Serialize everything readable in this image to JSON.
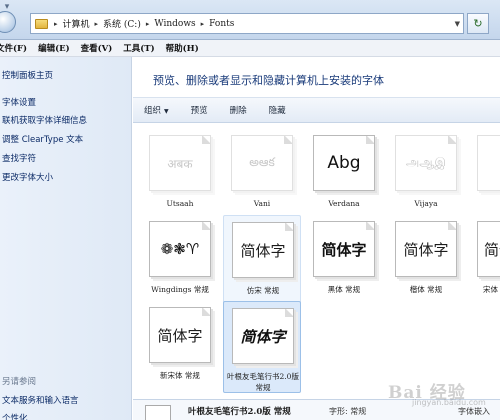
{
  "address": {
    "crumbs": [
      "计算机",
      "系统 (C:)",
      "Windows",
      "Fonts"
    ],
    "separator": "▸"
  },
  "menu": [
    "文件(F)",
    "编辑(E)",
    "查看(V)",
    "工具(T)",
    "帮助(H)"
  ],
  "sidebar": {
    "home": "控制面板主页",
    "links": [
      "字体设置",
      "联机获取字体详细信息",
      "调整 ClearType 文本",
      "查找字符",
      "更改字体大小"
    ],
    "see_also": "另请参阅",
    "bottom_links": [
      "文本服务和输入语言",
      "个性化"
    ]
  },
  "header": {
    "title": "预览、删除或者显示和隐藏计算机上安装的字体"
  },
  "toolbar": {
    "organize": "组织",
    "preview": "预览",
    "delete": "删除",
    "hide": "隐藏"
  },
  "fonts": [
    {
      "name": "Utsaah",
      "sample": "अबक"
    },
    {
      "name": "Vani",
      "sample": "అఆక"
    },
    {
      "name": "Verdana",
      "sample": "Abg"
    },
    {
      "name": "Vijaya",
      "sample": "அஆஇ"
    },
    {
      "name": "Wingdings 常规",
      "sample": "❁❃♈"
    },
    {
      "name": "仿宋 常规",
      "sample": "简体字"
    },
    {
      "name": "黑体 常规",
      "sample": "简体字"
    },
    {
      "name": "楷体 常规",
      "sample": "简体字"
    },
    {
      "name": "宋体",
      "sample": "简体"
    },
    {
      "name": "新宋体 常规",
      "sample": "简体字"
    },
    {
      "name": "叶根友毛笔行书2.0版 常规",
      "sample": "简体字"
    }
  ],
  "details": {
    "name": "叶根友毛笔行书2.0版 常规",
    "style": "字形: 常规",
    "embed": "字体嵌入"
  },
  "watermark": {
    "main": "Bai 经验",
    "sub": "jingyan.baidu.com"
  },
  "colors": {
    "accent": "#1a3b7a",
    "link": "#0b2a66",
    "selection": "#dbe9fa"
  }
}
